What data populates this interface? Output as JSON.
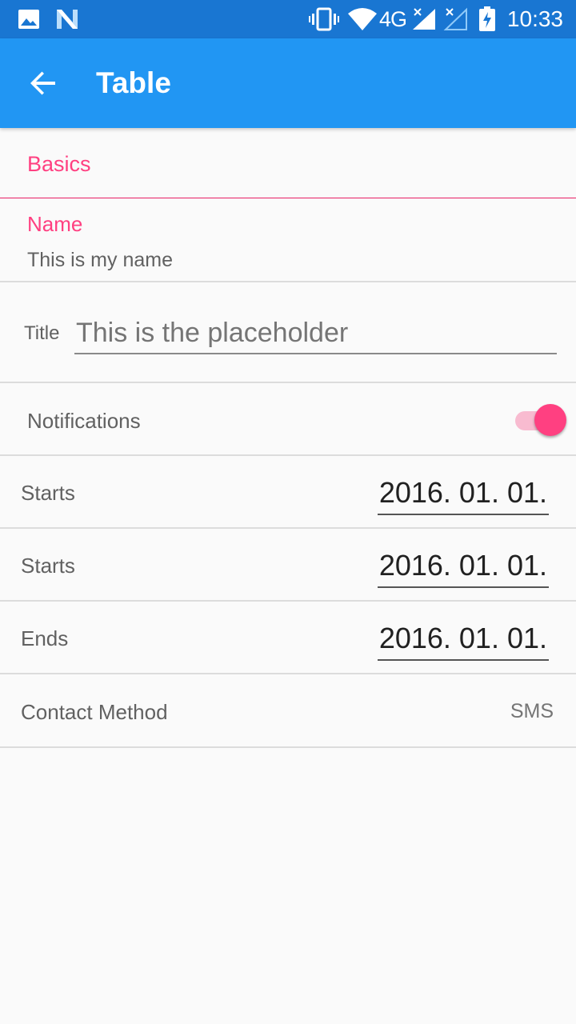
{
  "status_bar": {
    "time": "10:33",
    "network": "4G",
    "icons": [
      "image-icon",
      "n-notification-icon",
      "vibrate-icon",
      "wifi-icon",
      "signal-icon",
      "signal-2-icon",
      "battery-charging-icon"
    ]
  },
  "app_bar": {
    "title": "Table",
    "back_icon": "arrow-back-icon"
  },
  "form": {
    "section_header": "Basics",
    "name": {
      "label": "Name",
      "value": "This is my name"
    },
    "title": {
      "label": "Title",
      "placeholder": "This is the placeholder"
    },
    "notifications": {
      "label": "Notifications",
      "enabled": true
    },
    "dates": [
      {
        "label": "Starts",
        "value": "2016. 01. 01."
      },
      {
        "label": "Starts",
        "value": "2016. 01. 01."
      },
      {
        "label": "Ends",
        "value": "2016. 01. 01."
      }
    ],
    "contact_method": {
      "label": "Contact Method",
      "value": "SMS"
    }
  },
  "colors": {
    "status_bar": "#1976d2",
    "app_bar": "#2196f3",
    "accent": "#ff4081",
    "background": "#fafafa"
  }
}
